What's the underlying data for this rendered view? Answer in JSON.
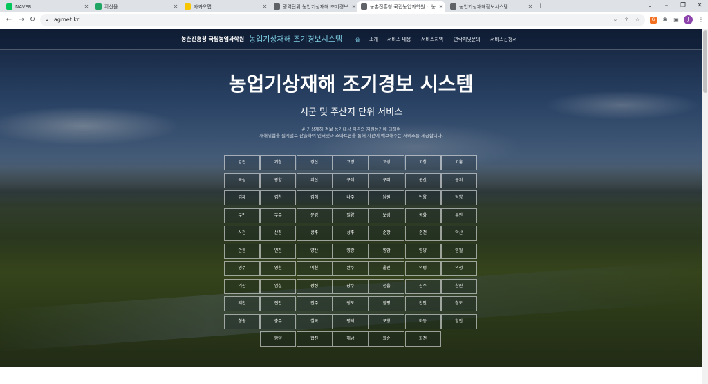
{
  "browser": {
    "tabs": [
      {
        "title": "NAVER",
        "color": "#03c75a",
        "active": false
      },
      {
        "title": "확산율",
        "color": "#1fa463",
        "active": false
      },
      {
        "title": "카카오맵",
        "color": "#f7c600",
        "active": false
      },
      {
        "title": "광역단위 농업기상재해 조기경보",
        "color": "#5f6368",
        "active": false
      },
      {
        "title": "농촌진흥청 국립농업과학원 :: 농",
        "color": "#5f6368",
        "active": true
      },
      {
        "title": "농업기상재해정보시스템",
        "color": "#5f6368",
        "active": false
      }
    ],
    "new_tab": "+",
    "url": "agmet.kr",
    "window_controls": [
      "⌄",
      "–",
      "❐",
      "✕"
    ]
  },
  "site": {
    "brand_sub": "농촌진흥청 국립농업과학원",
    "brand_main": "농업기상재해 조기경보시스템",
    "nav": [
      "홈",
      "소개",
      "서비스 내용",
      "서비스지역",
      "연락처및문의",
      "서비스신청서"
    ]
  },
  "hero": {
    "title": "농업기상재해 조기경보 시스템",
    "subtitle": "시군 및 주산지 단위 서비스",
    "desc_line1": "# 기상재해 경보 농가대상 지역의 자원농가에 대하여",
    "desc_line2": "재해위험을 필지별로 산출하여 인터넷과 스마트폰을 통해 사전에 예보해주는 서비스를 제공합니다."
  },
  "regions": [
    [
      "강진",
      "거창",
      "경산",
      "고령",
      "고성",
      "고창",
      "고흥"
    ],
    [
      "곡성",
      "광양",
      "괴산",
      "구례",
      "구미",
      "군산",
      "군위"
    ],
    [
      "김제",
      "김천",
      "김해",
      "나주",
      "남원",
      "단양",
      "담양"
    ],
    [
      "무안",
      "무주",
      "문경",
      "밀양",
      "보성",
      "봉화",
      "부안"
    ],
    [
      "사천",
      "산청",
      "상주",
      "성주",
      "순창",
      "순천",
      "악산"
    ],
    [
      "안동",
      "연천",
      "양산",
      "영광",
      "영암",
      "영양",
      "영월"
    ],
    [
      "영주",
      "영천",
      "예천",
      "완주",
      "울진",
      "의령",
      "의성"
    ],
    [
      "익산",
      "임실",
      "장성",
      "장수",
      "정읍",
      "진주",
      "창원"
    ],
    [
      "제천",
      "진안",
      "진주",
      "청도",
      "함평",
      "천안",
      "청도"
    ],
    [
      "청송",
      "충주",
      "칠곡",
      "평택",
      "포항",
      "하동",
      "함안"
    ],
    [
      "함양",
      "합천",
      "해남",
      "화순",
      "화천"
    ]
  ]
}
